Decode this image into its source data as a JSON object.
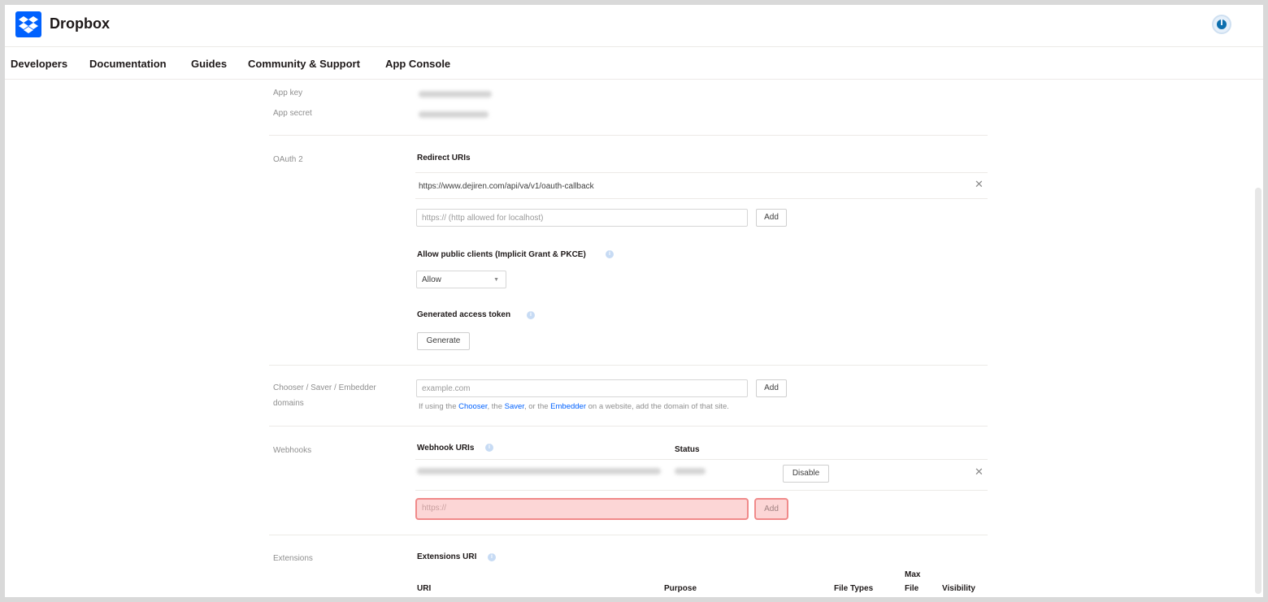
{
  "header": {
    "brand": "Dropbox"
  },
  "nav": {
    "items": [
      "Developers",
      "Documentation",
      "Guides",
      "Community & Support",
      "App Console"
    ]
  },
  "app_info": {
    "key_label": "App key",
    "secret_label": "App secret"
  },
  "oauth": {
    "section_label": "OAuth 2",
    "redirect_title": "Redirect URIs",
    "redirect_uri": "https://www.dejiren.com/api/va/v1/oauth-callback",
    "redirect_placeholder": "https:// (http allowed for localhost)",
    "add_label": "Add",
    "public_clients_title": "Allow public clients (Implicit Grant & PKCE)",
    "public_clients_value": "Allow",
    "token_title": "Generated access token",
    "generate_label": "Generate"
  },
  "chooser": {
    "label_line1": "Chooser / Saver / Embedder",
    "label_line2": "domains",
    "placeholder": "example.com",
    "add_label": "Add",
    "help_prefix": "If using the ",
    "chooser_link": "Chooser",
    "comma": ", the ",
    "saver_link": "Saver",
    "or_the": ", or the ",
    "embedder_link": "Embedder",
    "help_suffix": " on a website, add the domain of that site."
  },
  "webhooks": {
    "section_label": "Webhooks",
    "uris_title": "Webhook URIs",
    "status_title": "Status",
    "disable_label": "Disable",
    "new_placeholder": "https://",
    "add_label": "Add"
  },
  "extensions": {
    "section_label": "Extensions",
    "uri_title": "Extensions URI",
    "columns": {
      "uri": "URI",
      "purpose": "Purpose",
      "file_types": "File Types",
      "max_file_1": "Max",
      "max_file_2": "File",
      "visibility": "Visibility"
    }
  },
  "colors": {
    "accent": "#0061fe",
    "highlight_fill": "#fcd6d6",
    "highlight_border": "#f08a8a"
  }
}
